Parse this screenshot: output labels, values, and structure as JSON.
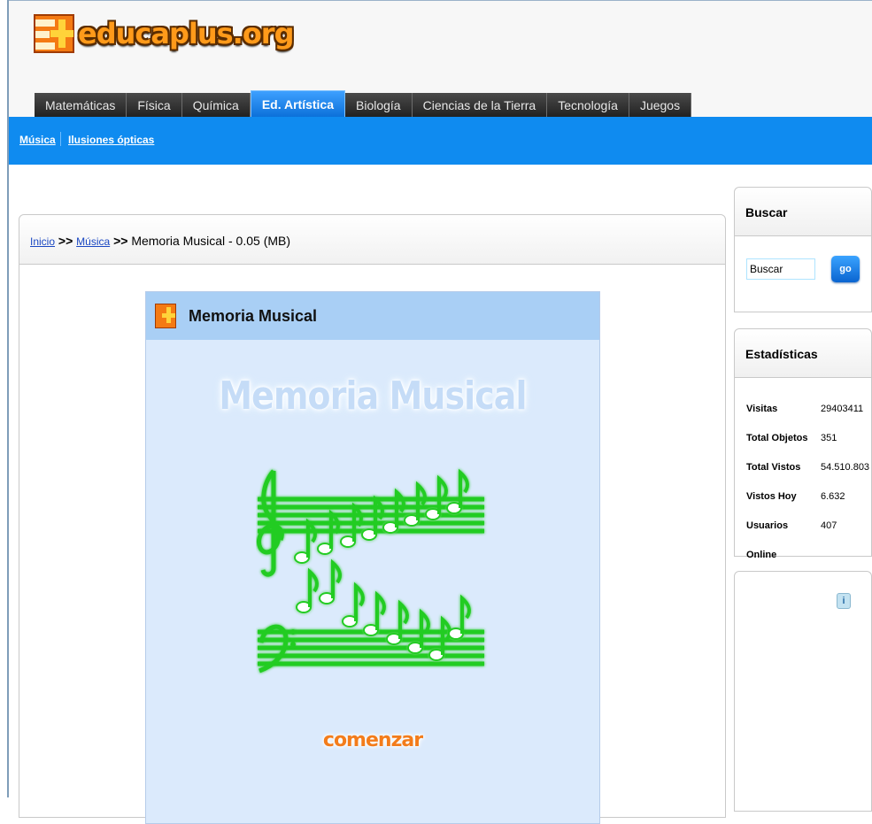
{
  "site": {
    "logo_text": "educaplus.org"
  },
  "tabs": [
    {
      "label": "Matemáticas",
      "active": false
    },
    {
      "label": "Física",
      "active": false
    },
    {
      "label": "Química",
      "active": false
    },
    {
      "label": "Ed. Artística",
      "active": true
    },
    {
      "label": "Biología",
      "active": false
    },
    {
      "label": "Ciencias de la Tierra",
      "active": false
    },
    {
      "label": "Tecnología",
      "active": false
    },
    {
      "label": "Juegos",
      "active": false
    }
  ],
  "subnav": {
    "items": [
      "Música",
      "Ilusiones ópticas"
    ]
  },
  "breadcrumb": {
    "home": "Inicio",
    "separator": ">>",
    "section": "Música",
    "current": "Memoria Musical - 0.05 (MB)"
  },
  "game": {
    "title": "Memoria Musical",
    "big_title": "Memoria Musical",
    "start_label": "comenzar"
  },
  "search": {
    "heading": "Buscar",
    "value": "Buscar",
    "button": "go"
  },
  "stats": {
    "heading": "Estadísticas",
    "rows": [
      {
        "label": "Visitas",
        "value": "29403411"
      },
      {
        "label": "Total Objetos",
        "value": "351"
      },
      {
        "label": "Total Vistos",
        "value": "54.510.803"
      },
      {
        "label": "Vistos Hoy",
        "value": "6.632"
      },
      {
        "label": "Usuarios Online",
        "value": "407"
      }
    ]
  },
  "ad": {
    "info_icon": "info-icon"
  },
  "colors": {
    "accent": "#0f8bf0",
    "tab_dark": "#2c2c2c",
    "note_green": "#22cc22",
    "game_bg": "#dbeafc",
    "start_orange": "#f37c1b"
  }
}
